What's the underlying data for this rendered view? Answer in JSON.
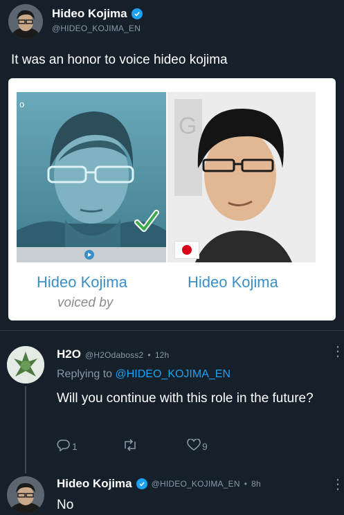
{
  "original_tweet": {
    "author_name": "Hideo Kojima",
    "handle": "@HIDEO_KOJIMA_EN",
    "text": "It was an honor to voice hideo kojima"
  },
  "card": {
    "left_caption": "Hideo Kojima",
    "left_sub_caption": "voiced by",
    "right_caption": "Hideo Kojima",
    "corner_mark": "o"
  },
  "reply": {
    "author_name": "H2O",
    "handle": "@H2Odaboss2",
    "time": "12h",
    "replying_prefix": "Replying to",
    "replying_handle": "@HIDEO_KOJIMA_EN",
    "text": "Will you continue with this role in the future?",
    "reply_count": "1",
    "retweet_count": "",
    "like_count": "9"
  },
  "response": {
    "author_name": "Hideo Kojima",
    "handle": "@HIDEO_KOJIMA_EN",
    "time": "8h",
    "text": "No"
  },
  "colors": {
    "background": "#15202b",
    "accent": "#1da1f2",
    "secondary_text": "#8899a6",
    "card_caption": "#3a8fc7"
  }
}
